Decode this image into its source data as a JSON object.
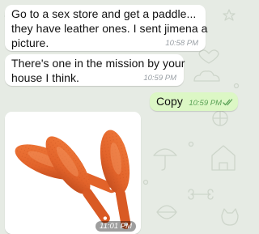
{
  "colors": {
    "chat_background": "#e6ebe4",
    "incoming_bubble": "#ffffff",
    "outgoing_bubble": "#dcf7c5",
    "outgoing_time": "#5aa256",
    "paddle": "#e2632a"
  },
  "messages": [
    {
      "direction": "incoming",
      "lines": [
        "Go to a sex store and get a paddle...",
        "they have leather ones. I sent jimena a",
        "picture."
      ],
      "time": "10:58 PM"
    },
    {
      "direction": "incoming",
      "lines": [
        "There's one in the mission by your",
        "house I think."
      ],
      "time": "10:59 PM"
    },
    {
      "direction": "outgoing",
      "lines": [
        "Copy"
      ],
      "time": "10:59 PM",
      "status_icon": "double-check-icon"
    },
    {
      "direction": "incoming",
      "type": "photo",
      "photo_subject": "three-orange-paddles",
      "time": "11:01 PM"
    }
  ]
}
